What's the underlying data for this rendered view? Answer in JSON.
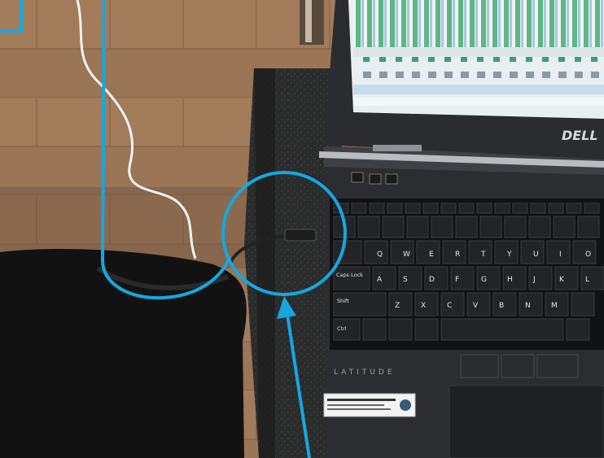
{
  "laptop": {
    "brand": "DELL",
    "model": "LATITUDE",
    "sticker_line1": "",
    "sticker_line2": ""
  },
  "keyboard": {
    "capslock_label": "Caps Lock",
    "shift_label": "Shift",
    "ctrl_label": "Ctrl",
    "letters_row1": [
      "Q",
      "W",
      "E",
      "R",
      "T",
      "Y",
      "U",
      "I",
      "O"
    ],
    "letters_row2": [
      "A",
      "S",
      "D",
      "F",
      "G",
      "H",
      "J",
      "K",
      "L"
    ],
    "letters_row3": [
      "Z",
      "X",
      "C",
      "V",
      "B",
      "N",
      "M"
    ]
  },
  "annotation": {
    "color": "#14a8e0"
  }
}
